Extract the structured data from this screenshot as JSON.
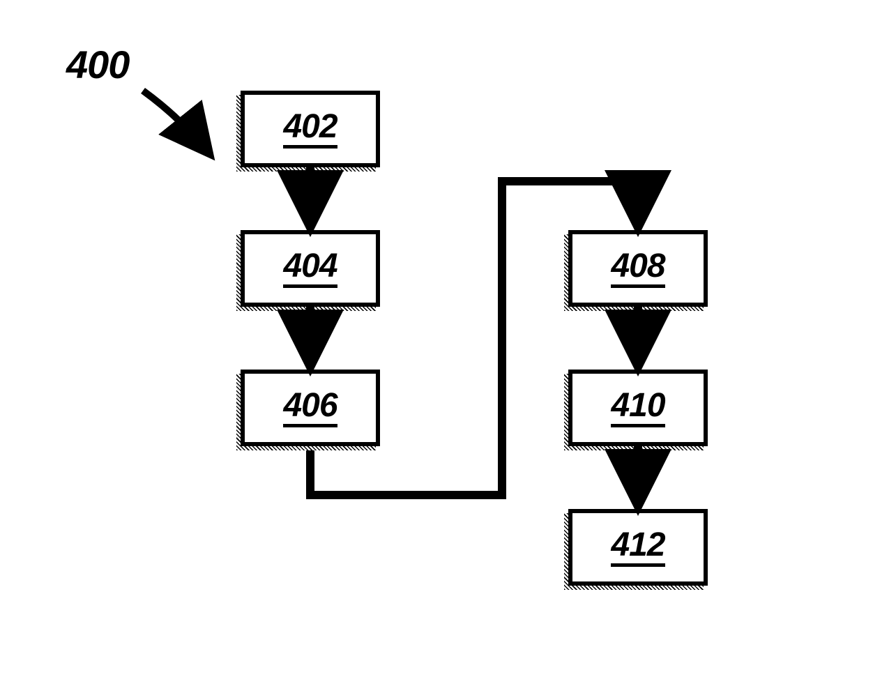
{
  "title": "400",
  "boxes": {
    "b402": "402",
    "b404": "404",
    "b406": "406",
    "b408": "408",
    "b410": "410",
    "b412": "412"
  }
}
